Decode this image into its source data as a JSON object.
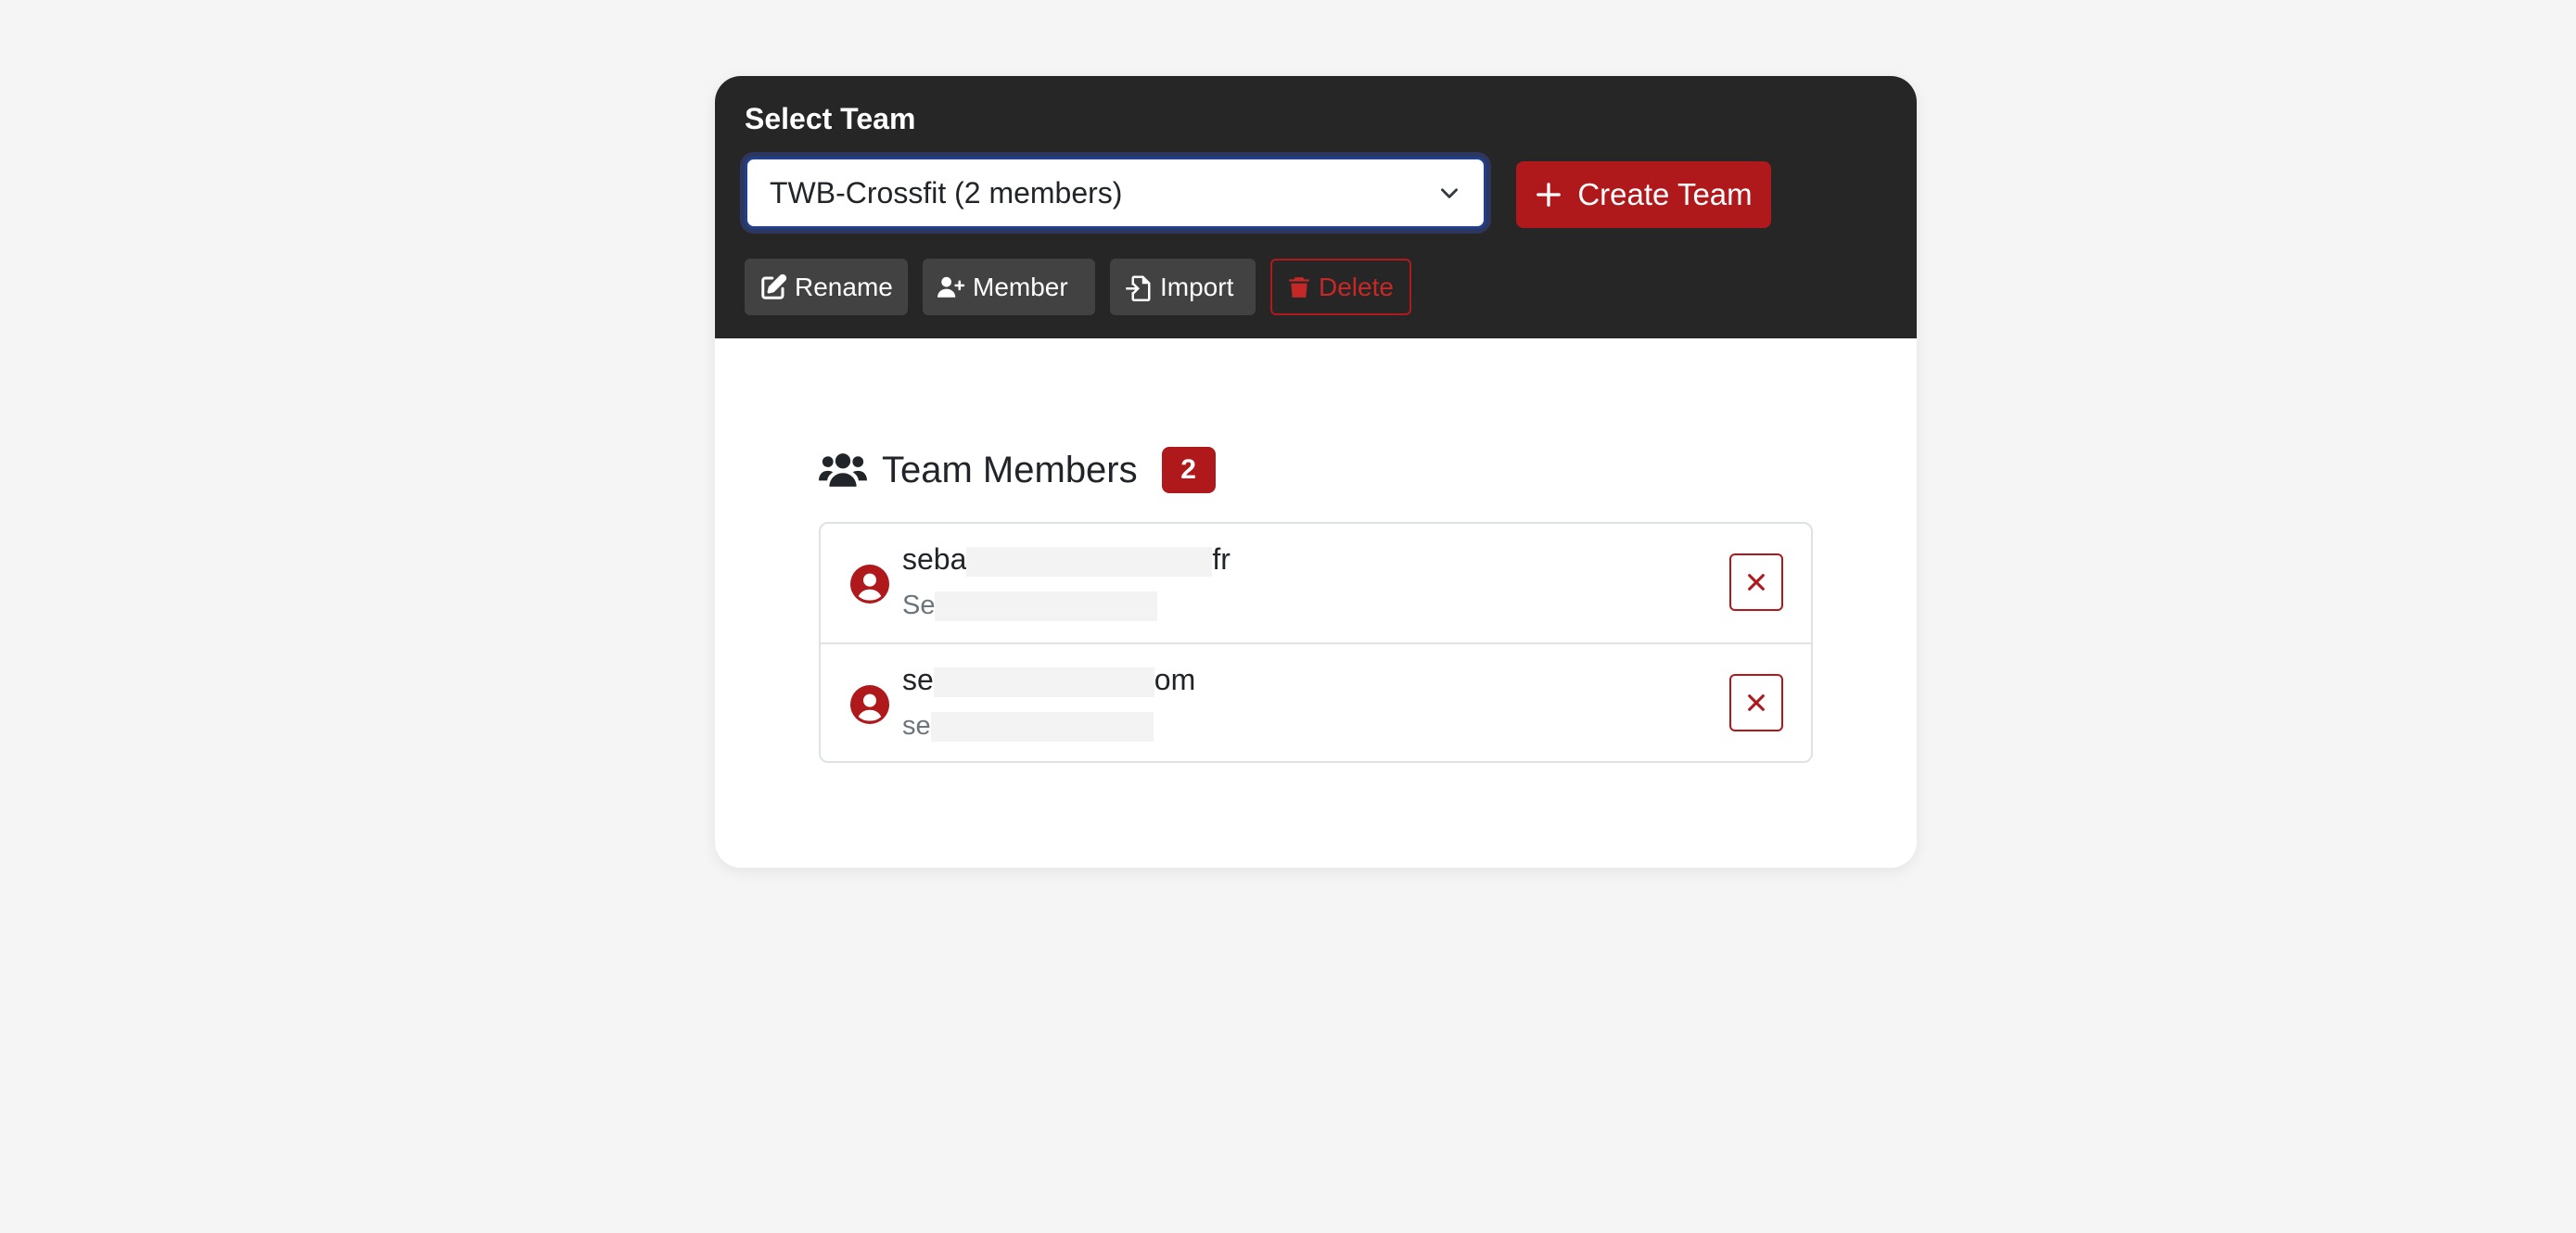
{
  "header": {
    "select_label": "Select Team",
    "selected_team": "TWB-Crossfit (2 members)",
    "create_button_label": "Create Team",
    "actions": {
      "rename": "Rename",
      "member": "Member",
      "import": "Import",
      "delete": "Delete"
    }
  },
  "members": {
    "title": "Team Members",
    "count": "2",
    "items": [
      {
        "email_start": "seba",
        "email_end": "fr",
        "name_start": "Se"
      },
      {
        "email_start": "se",
        "email_end": "om",
        "name_start": "se"
      }
    ]
  },
  "colors": {
    "accent": "#b0191c",
    "header_bg": "#262626",
    "action_bg": "#424242",
    "page_bg": "#f5f5f5"
  },
  "icons": {
    "select": "chevron-down-icon",
    "create": "plus-icon",
    "rename": "edit-icon",
    "member": "user-plus-icon",
    "import": "file-import-icon",
    "delete": "trash-icon",
    "members_title": "users-icon",
    "member_avatar": "user-circle-icon",
    "remove": "close-icon"
  }
}
